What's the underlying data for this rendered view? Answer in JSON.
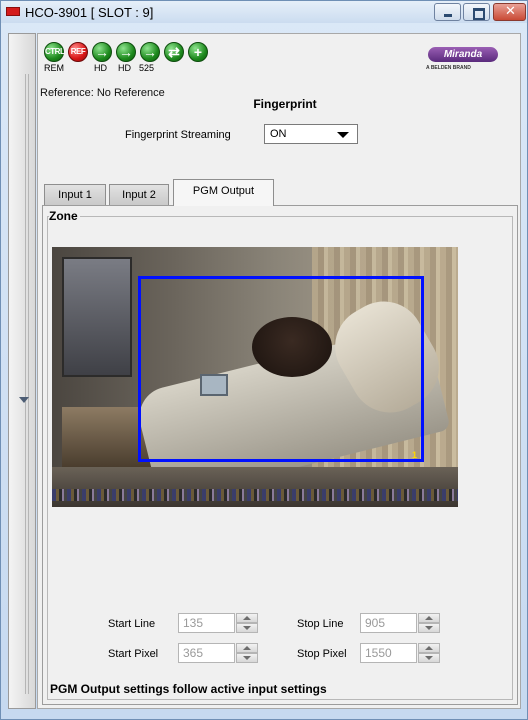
{
  "window": {
    "title": "HCO-3901 [ SLOT : 9]"
  },
  "toolbar": {
    "status_icons": [
      {
        "name": "ctrl-status-icon",
        "label": "CTRL",
        "caption": "REM",
        "color": "green"
      },
      {
        "name": "ref-status-icon",
        "label": "REF",
        "caption": "",
        "color": "red"
      },
      {
        "name": "input1-status-icon",
        "label": "→",
        "caption": "HD",
        "color": "green"
      },
      {
        "name": "input2-status-icon",
        "label": "→",
        "caption": "HD",
        "color": "green"
      },
      {
        "name": "output-status-icon",
        "label": "→",
        "caption": "525",
        "color": "green"
      },
      {
        "name": "switch-status-icon",
        "label": "⇄",
        "caption": "",
        "color": "green"
      },
      {
        "name": "add-status-icon",
        "label": "+",
        "caption": "",
        "color": "green"
      }
    ],
    "logo_text": "Miranda",
    "logo_sub": "A BELDEN BRAND"
  },
  "reference": "Reference: No Reference",
  "section_title": "Fingerprint",
  "streaming": {
    "label": "Fingerprint Streaming",
    "value": "ON"
  },
  "tabs": [
    {
      "label": "Input 1",
      "active": false
    },
    {
      "label": "Input 2",
      "active": false
    },
    {
      "label": "PGM Output",
      "active": true
    }
  ],
  "zone": {
    "title": "Zone",
    "overlay_number": "1",
    "start_line": {
      "label": "Start Line",
      "value": "135"
    },
    "stop_line": {
      "label": "Stop Line",
      "value": "905"
    },
    "start_pixel": {
      "label": "Start Pixel",
      "value": "365"
    },
    "stop_pixel": {
      "label": "Stop Pixel",
      "value": "1550"
    }
  },
  "footer_note": "PGM Output settings follow active input settings",
  "colors": {
    "zone_rect": "#0010ff",
    "title_bar": "#cbdcf0",
    "status_green": "#1e8a1e",
    "status_red": "#d81515"
  }
}
